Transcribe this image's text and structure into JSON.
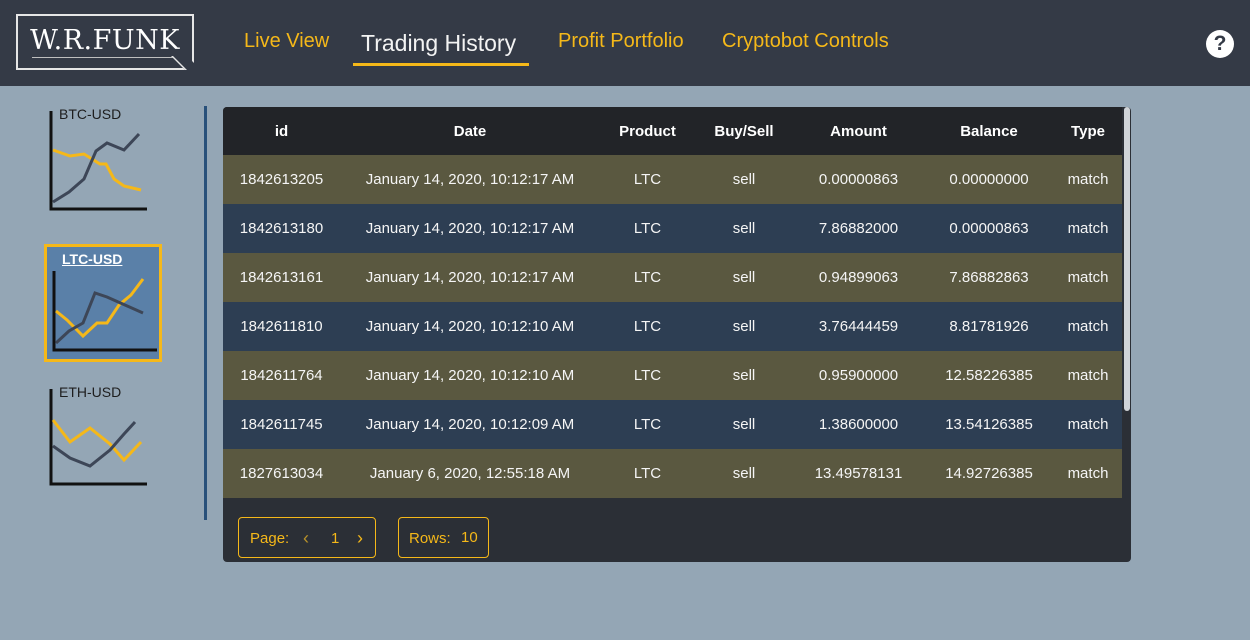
{
  "header": {
    "logo_text": "W.R.FUNK",
    "nav": [
      "Live View",
      "Trading History",
      "Profit Portfolio",
      "Cryptobot Controls"
    ],
    "active_nav": "Trading History",
    "help_glyph": "?"
  },
  "sidebar": {
    "symbols": [
      {
        "label": "BTC-USD",
        "active": false
      },
      {
        "label": "LTC-USD",
        "active": true
      },
      {
        "label": "ETH-USD",
        "active": false
      }
    ]
  },
  "table": {
    "columns": [
      "id",
      "Date",
      "Product",
      "Buy/Sell",
      "Amount",
      "Balance",
      "Type"
    ],
    "rows": [
      [
        "1842613205",
        "January 14, 2020, 10:12:17 AM",
        "LTC",
        "sell",
        "0.00000863",
        "0.00000000",
        "match"
      ],
      [
        "1842613180",
        "January 14, 2020, 10:12:17 AM",
        "LTC",
        "sell",
        "7.86882000",
        "0.00000863",
        "match"
      ],
      [
        "1842613161",
        "January 14, 2020, 10:12:17 AM",
        "LTC",
        "sell",
        "0.94899063",
        "7.86882863",
        "match"
      ],
      [
        "1842611810",
        "January 14, 2020, 10:12:10 AM",
        "LTC",
        "sell",
        "3.76444459",
        "8.81781926",
        "match"
      ],
      [
        "1842611764",
        "January 14, 2020, 10:12:10 AM",
        "LTC",
        "sell",
        "0.95900000",
        "12.58226385",
        "match"
      ],
      [
        "1842611745",
        "January 14, 2020, 10:12:09 AM",
        "LTC",
        "sell",
        "1.38600000",
        "13.54126385",
        "match"
      ],
      [
        "1827613034",
        "January 6, 2020, 12:55:18 AM",
        "LTC",
        "sell",
        "13.49578131",
        "14.92726385",
        "match"
      ]
    ]
  },
  "pagination": {
    "page_label": "Page:",
    "page_value": "1",
    "prev_glyph": "‹",
    "next_glyph": "›",
    "rows_label": "Rows:",
    "rows_value": "10"
  },
  "colors": {
    "accent": "#f5b819",
    "topbar": "#343a46",
    "background": "#94a6b5",
    "row_odd": "#5a5840",
    "row_even": "#2d3e53"
  }
}
